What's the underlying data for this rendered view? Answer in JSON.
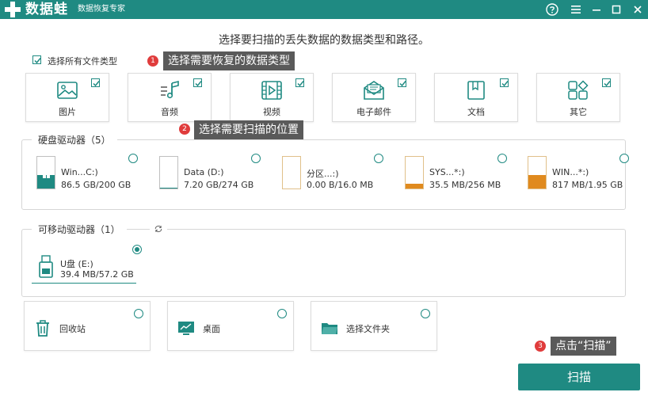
{
  "app": {
    "name": "数据蛙",
    "subtitle": "数据恢复专家"
  },
  "window_controls": [
    "help-icon",
    "menu-icon",
    "minimize-icon",
    "maximize-icon",
    "close-icon"
  ],
  "heading": "选择要扫描的丢失数据的数据类型和路径。",
  "select_all": {
    "label": "选择所有文件类型",
    "checked": true
  },
  "tips": [
    {
      "badge": "1",
      "text": "选择需要恢复的数据类型"
    },
    {
      "badge": "2",
      "text": "选择需要扫描的位置"
    },
    {
      "badge": "3",
      "text": "点击“扫描”"
    }
  ],
  "file_types": [
    {
      "label": "图片",
      "icon": "image-icon",
      "checked": true
    },
    {
      "label": "音频",
      "icon": "audio-icon",
      "checked": true
    },
    {
      "label": "视频",
      "icon": "video-icon",
      "checked": true
    },
    {
      "label": "电子邮件",
      "icon": "email-icon",
      "checked": true
    },
    {
      "label": "文档",
      "icon": "document-icon",
      "checked": true
    },
    {
      "label": "其它",
      "icon": "other-icon",
      "checked": true
    }
  ],
  "hard_drives": {
    "title": "硬盘驱动器（5）",
    "drives": [
      {
        "name": "Win...C:)",
        "size": "86.5 GB/200 GB",
        "used": 0.43,
        "fill_color": "#1f8a82",
        "selected": false
      },
      {
        "name": "Data (D:)",
        "size": "7.20 GB/274 GB",
        "used": 0.03,
        "fill_color": "#1f8a82",
        "selected": false
      },
      {
        "name": "分区...:)",
        "size": "0.00  B/16.0 MB",
        "used": 0.0,
        "fill_color": "#e08a1e",
        "selected": false
      },
      {
        "name": "SYS...*:)",
        "size": "35.5 MB/256 MB",
        "used": 0.14,
        "fill_color": "#e08a1e",
        "selected": false
      },
      {
        "name": "WIN...*:)",
        "size": "817 MB/1.95 GB",
        "used": 0.42,
        "fill_color": "#e08a1e",
        "selected": false
      }
    ]
  },
  "removable_drives": {
    "title": "可移动驱动器（1）",
    "refresh_icon": "refresh-icon",
    "drives": [
      {
        "name": "U盘 (E:)",
        "size": "39.4 MB/57.2 GB",
        "icon": "usb-icon",
        "selected": true
      }
    ]
  },
  "locations": [
    {
      "label": "回收站",
      "icon": "trash-icon",
      "selected": false
    },
    {
      "label": "桌面",
      "icon": "desktop-icon",
      "selected": false
    },
    {
      "label": "选择文件夹",
      "icon": "folder-icon",
      "selected": false
    }
  ],
  "scan_button": "扫描",
  "colors": {
    "accent": "#1f8a82",
    "warning": "#e08a1e",
    "badge": "#e03c3c",
    "tooltip": "#5a5a5a"
  }
}
